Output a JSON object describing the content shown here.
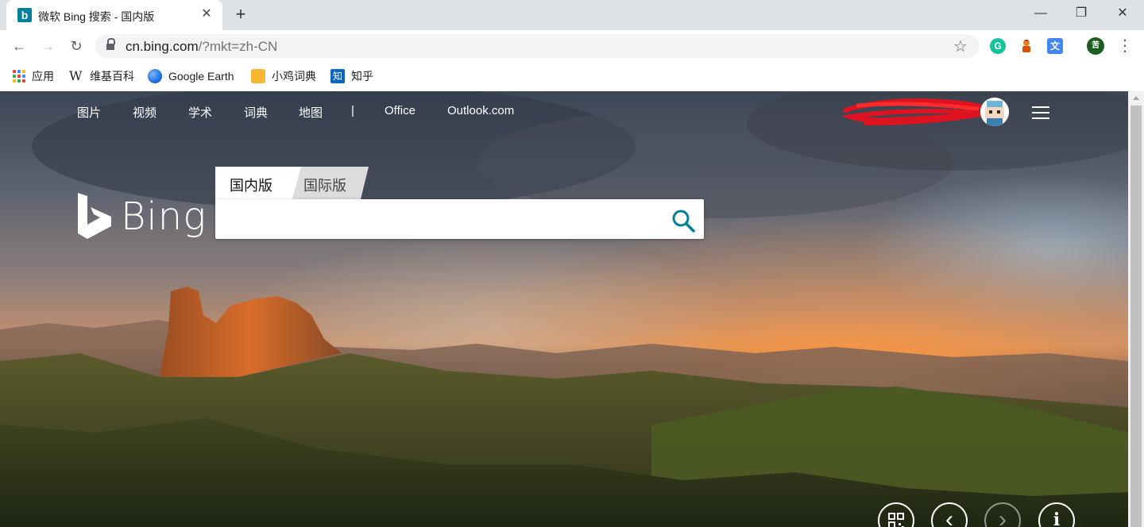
{
  "browser": {
    "tab": {
      "favicon": "b",
      "title": "微软 Bing 搜索 - 国内版",
      "close": "✕"
    },
    "new_tab": "+",
    "window": {
      "minimize": "—",
      "restore": "❐",
      "close": "✕"
    },
    "nav": {
      "back": "←",
      "forward": "→",
      "reload": "↻"
    },
    "url": {
      "host": "cn.bing.com",
      "path": "/?mkt=zh-CN"
    },
    "bookmark_star": "☆",
    "extensions": [
      {
        "name": "grammarly-icon",
        "label": "G",
        "color": "#15c39a"
      },
      {
        "name": "character-extension-icon",
        "label": "",
        "color": "#e67e22"
      },
      {
        "name": "translate-icon",
        "label": "文",
        "color": "#4285f4"
      },
      {
        "name": "profile-icon",
        "label": "苦",
        "color": "#1b5e20"
      }
    ],
    "menu": "⋮",
    "bookmarks": [
      {
        "name": "bookmark-apps",
        "label": "应用"
      },
      {
        "name": "bookmark-wikipedia",
        "label": "维基百科"
      },
      {
        "name": "bookmark-google-earth",
        "label": "Google Earth"
      },
      {
        "name": "bookmark-xiaoji",
        "label": "小鸡词典"
      },
      {
        "name": "bookmark-zhihu",
        "label": "知乎"
      }
    ]
  },
  "bing": {
    "nav": [
      "图片",
      "视频",
      "学术",
      "词典",
      "地图",
      "|",
      "Office",
      "Outlook.com"
    ],
    "logo_text": "Bing",
    "tabs": {
      "domestic": "国内版",
      "international": "国际版"
    },
    "search": {
      "value": "",
      "placeholder": ""
    },
    "bottom_buttons": {
      "qr": "qr-code-icon",
      "prev": "‹",
      "next": "›",
      "info": "i"
    }
  },
  "colors": {
    "tabstrip": "#dee1e6",
    "bing_teal": "#00809d",
    "search_icon": "#00809d"
  }
}
